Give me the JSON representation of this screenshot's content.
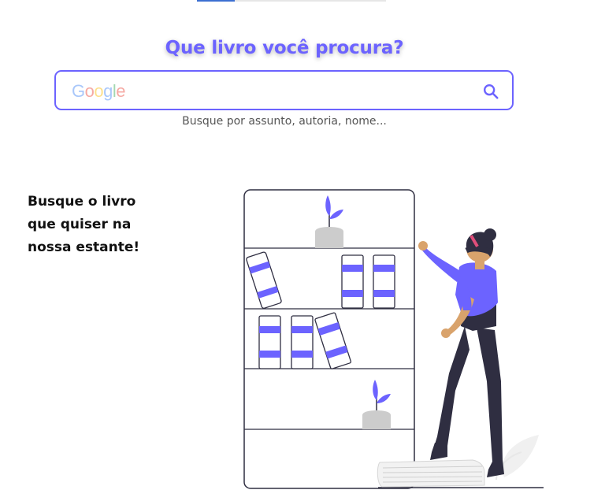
{
  "search": {
    "title": "Que livro você procura?",
    "logo_letters": [
      "G",
      "o",
      "o",
      "g",
      "l",
      "e"
    ],
    "placeholder": "",
    "helper": "Busque por assunto, autoria, nome..."
  },
  "promo": {
    "lines": [
      "Busque o livro",
      "que quiser na",
      "nossa estante!"
    ]
  },
  "icons": {
    "search": "search-icon"
  },
  "colors": {
    "accent": "#6c63ff",
    "dark": "#2f2e41",
    "skin": "#d9a36c",
    "plant_pot": "#cccccc"
  }
}
